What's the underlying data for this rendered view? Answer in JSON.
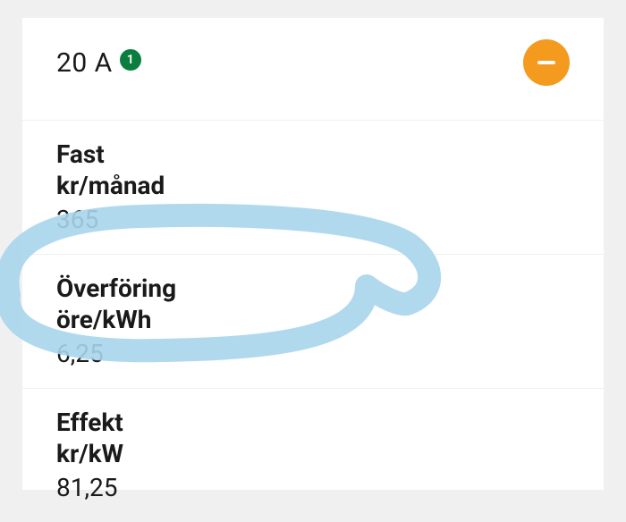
{
  "header": {
    "title": "20 A",
    "badge": "1"
  },
  "rows": [
    {
      "label1": "Fast",
      "label2": "kr/månad",
      "value": "365"
    },
    {
      "label1": "Överföring",
      "label2": "öre/kWh",
      "value": "6,25"
    },
    {
      "label1": "Effekt",
      "label2": "kr/kW",
      "value": "81,25"
    }
  ],
  "colors": {
    "badge": "#0a7d3f",
    "minusButton": "#f39a1f",
    "annotation": "#a8d5ec"
  }
}
